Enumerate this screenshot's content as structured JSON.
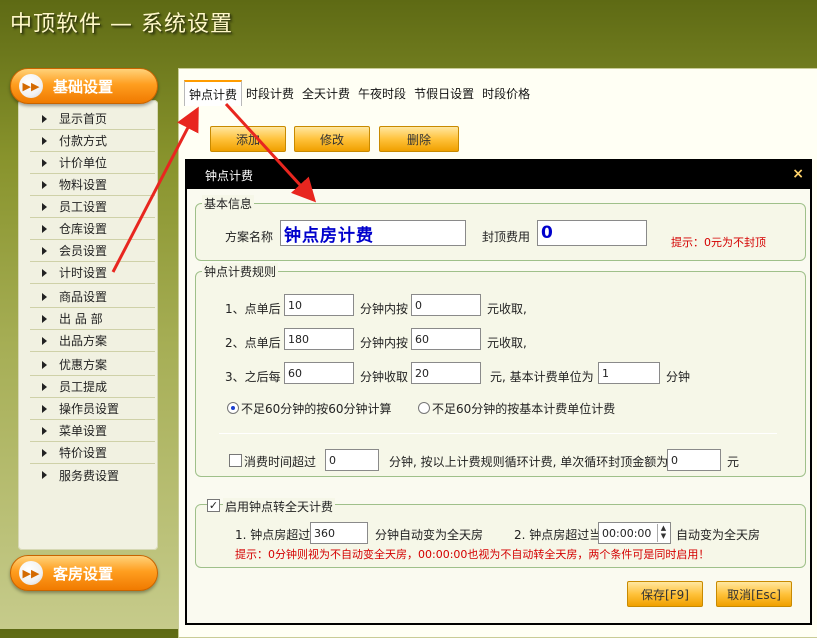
{
  "app": {
    "title": "中顶软件 — 系统设置"
  },
  "sidebar": {
    "top_label": "基础设置",
    "bottom_label": "客房设置",
    "items": [
      "显示首页",
      "付款方式",
      "计价单位",
      "物料设置",
      "员工设置",
      "仓库设置",
      "会员设置",
      "计时设置",
      "商品设置",
      "出 品 部",
      "出品方案",
      "优惠方案",
      "员工提成",
      "操作员设置",
      "菜单设置",
      "特价设置",
      "服务费设置"
    ]
  },
  "tabs": [
    "钟点计费",
    "时段计费",
    "全天计费",
    "午夜时段",
    "节假日设置",
    "时段价格"
  ],
  "toolbar": {
    "add": "添加",
    "edit": "修改",
    "delete": "删除"
  },
  "dialog": {
    "title": "钟点计费",
    "close": "×",
    "basic": {
      "legend": "基本信息",
      "scheme_label": "方案名称",
      "scheme_value": "钟点房计费",
      "cap_label": "封顶费用",
      "cap_value": "0",
      "hint": "提示：0元为不封顶"
    },
    "rules": {
      "legend": "钟点计费规则",
      "r1_prefix": "1、点单后",
      "r1_min": "10",
      "r1_mid": "分钟内按",
      "r1_amt": "0",
      "r1_suffix": "元收取,",
      "r2_prefix": "2、点单后",
      "r2_min": "180",
      "r2_mid": "分钟内按",
      "r2_amt": "60",
      "r2_suffix": "元收取,",
      "r3_prefix": "3、之后每",
      "r3_min": "60",
      "r3_mid": "分钟收取",
      "r3_amt": "20",
      "r3_unit_label": "元, 基本计费单位为",
      "r3_unit": "1",
      "r3_suffix": "分钟",
      "radio1": "不足60分钟的按60分钟计算",
      "radio2": "不足60分钟的按基本计费单位计费",
      "consume_label": "消费时间超过",
      "consume_value": "0",
      "consume_mid": "分钟, 按以上计费规则循环计费, 单次循环封顶金额为",
      "consume_cap": "0",
      "consume_suffix": "元"
    },
    "fullday": {
      "legend": "启用钟点转全天计费",
      "c1_prefix": "1. 钟点房超过",
      "c1_value": "360",
      "c1_suffix": "分钟自动变为全天房",
      "c2_prefix": "2. 钟点房超过当天",
      "c2_value": "00:00:00",
      "c2_suffix": "自动变为全天房",
      "hint": "提示：0分钟则视为不自动变全天房，00:00:00也视为不自动转全天房，两个条件可是同时启用！"
    },
    "save": "保存[F9]",
    "cancel": "取消[Esc]"
  },
  "colors": {
    "accent_orange": "#ff9e1f",
    "hint_red": "#d40000",
    "value_blue": "#0000cc"
  }
}
